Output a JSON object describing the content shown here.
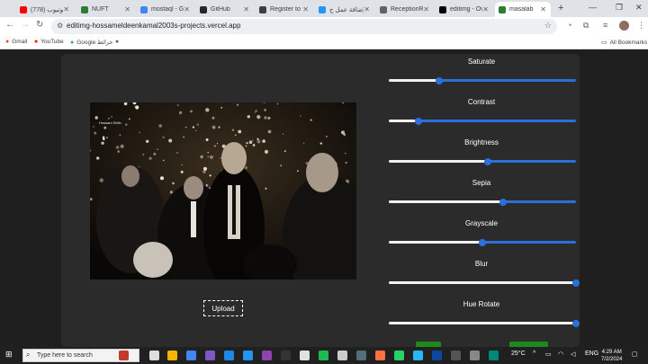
{
  "browser": {
    "tabs": [
      {
        "title": "(778) يوتيوب",
        "favicon": "youtube-icon",
        "color": "#ff0000"
      },
      {
        "title": "NUFT",
        "favicon": "vercel-icon",
        "color": "#2e7d32"
      },
      {
        "title": "mostaql - Go",
        "favicon": "google-icon",
        "color": "#4285f4"
      },
      {
        "title": "GitHub",
        "favicon": "github-icon",
        "color": "#24292e"
      },
      {
        "title": "Register to f",
        "favicon": "register-icon",
        "color": "#3c4043"
      },
      {
        "title": "إضافة عمل ج",
        "favicon": "mostaql-icon",
        "color": "#2196f3"
      },
      {
        "title": "ReceptionRo",
        "favicon": "globe-icon",
        "color": "#5f6368"
      },
      {
        "title": "editimg - Ove",
        "favicon": "vercel-icon",
        "color": "#000000"
      },
      {
        "title": "masalab",
        "favicon": "vercel-icon",
        "color": "#2e7d32"
      }
    ],
    "active_tab_index": 8,
    "url": "editimg-hossameldeenkamal2003s-projects.vercel.app",
    "bookmarks": [
      {
        "label": "Gmail",
        "icon": "gmail-icon",
        "color": "#ea4335"
      },
      {
        "label": "YouTube",
        "icon": "youtube-icon",
        "color": "#ff0000"
      },
      {
        "label": "Google خرائط",
        "icon": "maps-icon",
        "color": "#34a853"
      },
      {
        "label": "",
        "icon": "history-icon",
        "color": "#5f6368"
      }
    ],
    "all_bookmarks": "All Bookmarks"
  },
  "app": {
    "upload_label": "Upload",
    "image_caption": "Hossam Eldin",
    "controls": [
      {
        "label": "Saturate",
        "value": 0.27
      },
      {
        "label": "Contrast",
        "value": 0.16
      },
      {
        "label": "Brightness",
        "value": 0.53
      },
      {
        "label": "Sepia",
        "value": 0.61
      },
      {
        "label": "Grayscale",
        "value": 0.5
      },
      {
        "label": "Blur",
        "value": 1.0
      },
      {
        "label": "Hue Rotate",
        "value": 1.0
      }
    ]
  },
  "taskbar": {
    "search_placeholder": "Type here to search",
    "weather": "25°C",
    "language": "ENG",
    "time": "4:29 AM",
    "date": "7/2/2024"
  }
}
